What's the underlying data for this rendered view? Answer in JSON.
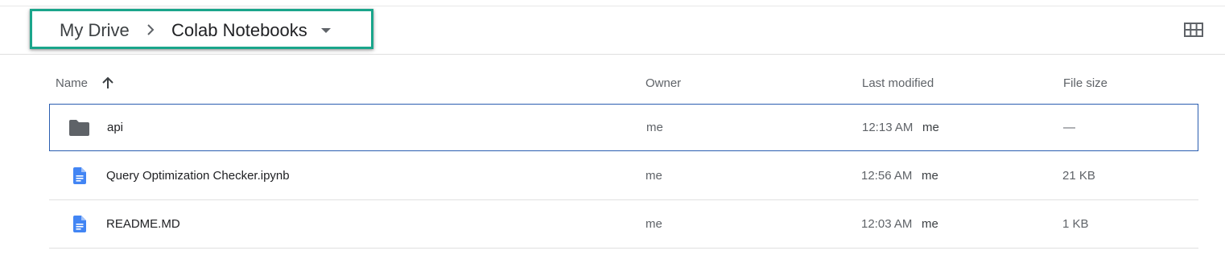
{
  "breadcrumb": {
    "root": "My Drive",
    "current": "Colab Notebooks"
  },
  "icons": {
    "separator": "chevron-right-icon",
    "dropdown": "caret-down-icon",
    "view_toggle": "grid-view-icon",
    "sort": "arrow-up-icon",
    "folder": "folder-icon",
    "document": "google-doc-icon"
  },
  "colors": {
    "highlight_border": "#1aa58b",
    "selected_row_border": "#2a5db0",
    "doc_icon": "#4285f4",
    "folder_icon": "#5f6368"
  },
  "table": {
    "headers": {
      "name": "Name",
      "owner": "Owner",
      "last_modified": "Last modified",
      "file_size": "File size"
    },
    "sort": {
      "column": "name",
      "direction": "ascending"
    },
    "rows": [
      {
        "type": "folder",
        "name": "api",
        "owner": "me",
        "modified_time": "12:13 AM",
        "modified_by": "me",
        "size": "—",
        "selected": true
      },
      {
        "type": "document",
        "name": "Query Optimization Checker.ipynb",
        "owner": "me",
        "modified_time": "12:56 AM",
        "modified_by": "me",
        "size": "21 KB",
        "selected": false
      },
      {
        "type": "document",
        "name": "README.MD",
        "owner": "me",
        "modified_time": "12:03 AM",
        "modified_by": "me",
        "size": "1 KB",
        "selected": false
      }
    ]
  }
}
